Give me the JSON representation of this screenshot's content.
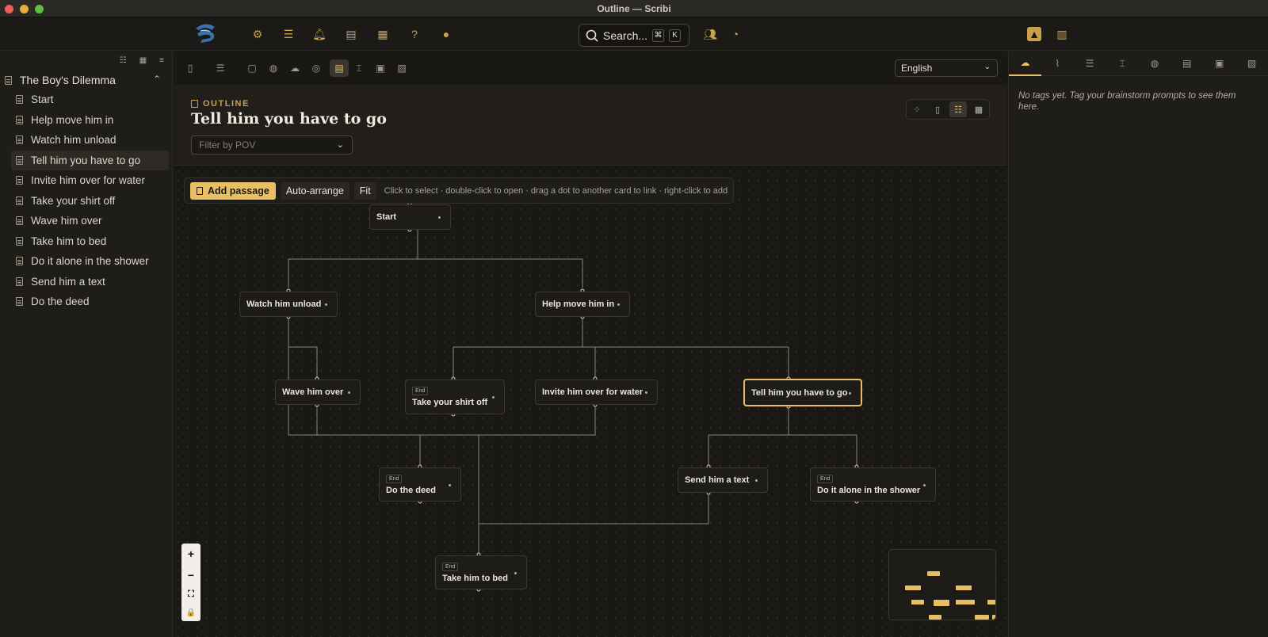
{
  "window": {
    "title": "Outline — Scribi",
    "colors": {
      "close": "#ec5f57",
      "minimize": "#e0b23a",
      "zoom": "#5fbd48",
      "accent": "#e8c063"
    }
  },
  "topbar": {
    "icons": [
      "gear-icon",
      "checklist-icon",
      "bell-icon",
      "cards-icon",
      "calendar-icon",
      "help-icon",
      "chat-icon",
      "users-icon",
      "history-icon",
      "bell-badge-icon",
      "split-panel-icon"
    ],
    "search": {
      "label": "Search...",
      "key1": "⌘",
      "key2": "K"
    }
  },
  "sidebar": {
    "project": "The Boy's Dilemma",
    "items": [
      {
        "label": "Start"
      },
      {
        "label": "Help move him in"
      },
      {
        "label": "Watch him unload"
      },
      {
        "label": "Tell him you have to go"
      },
      {
        "label": "Invite him over for water"
      },
      {
        "label": "Take your shirt off"
      },
      {
        "label": "Wave him over"
      },
      {
        "label": "Take him to bed"
      },
      {
        "label": "Do it alone in the shower"
      },
      {
        "label": "Send him a text"
      },
      {
        "label": "Do the deed"
      }
    ],
    "selected_index": 3
  },
  "main": {
    "language": "English",
    "section_label": "OUTLINE",
    "title": "Tell him you have to go",
    "pov_placeholder": "Filter by POV",
    "toolbar": {
      "add": "Add passage",
      "arrange": "Auto-arrange",
      "fit": "Fit",
      "hint": "Click to select · double-click to open · drag a dot to another card to link · right-click to add"
    },
    "nodes": {
      "start": {
        "label": "Start"
      },
      "watch": {
        "label": "Watch him unload"
      },
      "help": {
        "label": "Help move him in"
      },
      "wave": {
        "label": "Wave him over"
      },
      "shirt": {
        "label": "Take your shirt off",
        "badge": "End"
      },
      "invite": {
        "label": "Invite him over for water"
      },
      "tell": {
        "label": "Tell him you have to go"
      },
      "deed": {
        "label": "Do the deed",
        "badge": "End"
      },
      "text": {
        "label": "Send him a text"
      },
      "shower": {
        "label": "Do it alone in the shower",
        "badge": "End"
      },
      "bed": {
        "label": "Take him to bed",
        "badge": "End"
      }
    },
    "zoom": {
      "in": "+",
      "out": "−",
      "fit": "⛶",
      "lock": "🔒"
    }
  },
  "rpanel": {
    "empty_text": "No tags yet. Tag your brainstorm prompts to see them here."
  }
}
